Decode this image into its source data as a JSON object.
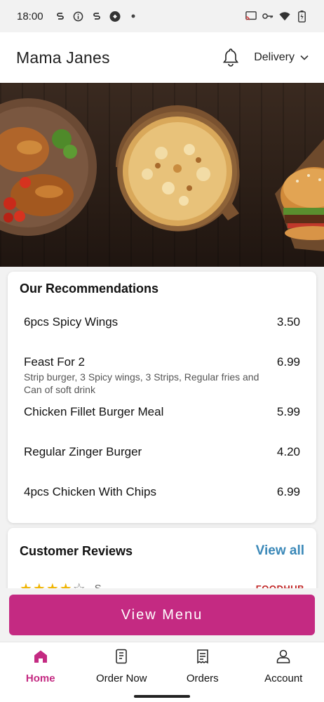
{
  "status_bar": {
    "time": "18:00",
    "left_icons": [
      "s-icon",
      "info-icon",
      "s-icon",
      "shield-icon",
      "dot-icon"
    ],
    "right_icons": [
      "cast-icon",
      "key-icon",
      "wifi-icon",
      "battery-icon"
    ]
  },
  "header": {
    "title": "Mama Janes",
    "bell_icon": "bell-icon",
    "delivery_label": "Delivery",
    "dropdown_icon": "chevron-down-icon"
  },
  "hero": {
    "description_icons": [
      "grilled-chicken-plate",
      "pizza",
      "burger"
    ]
  },
  "recommendations": {
    "title": "Our Recommendations",
    "items": [
      {
        "name": "6pcs Spicy Wings",
        "price": "3.50",
        "desc": ""
      },
      {
        "name": "Feast For 2",
        "price": "6.99",
        "desc": "Strip burger, 3 Spicy wings, 3 Strips, Regular fries and Can of soft drink"
      },
      {
        "name": "Chicken Fillet Burger Meal",
        "price": "5.99",
        "desc": ""
      },
      {
        "name": "Regular Zinger Burger",
        "price": "4.20",
        "desc": ""
      },
      {
        "name": "4pcs Chicken With Chips",
        "price": "6.99",
        "desc": ""
      }
    ]
  },
  "reviews": {
    "title": "Customer Reviews",
    "view_all": "View all",
    "first_review_rating": 4,
    "first_review_initial": "S",
    "source": "FOODHUB"
  },
  "cta": {
    "label": "View Menu"
  },
  "nav": [
    {
      "label": "Home",
      "icon": "home-icon",
      "active": true
    },
    {
      "label": "Order Now",
      "icon": "order-icon",
      "active": false
    },
    {
      "label": "Orders",
      "icon": "receipt-icon",
      "active": false
    },
    {
      "label": "Account",
      "icon": "person-icon",
      "active": false
    }
  ],
  "colors": {
    "accent": "#c42a82",
    "link": "#3a88b8",
    "star": "#f0b400"
  }
}
